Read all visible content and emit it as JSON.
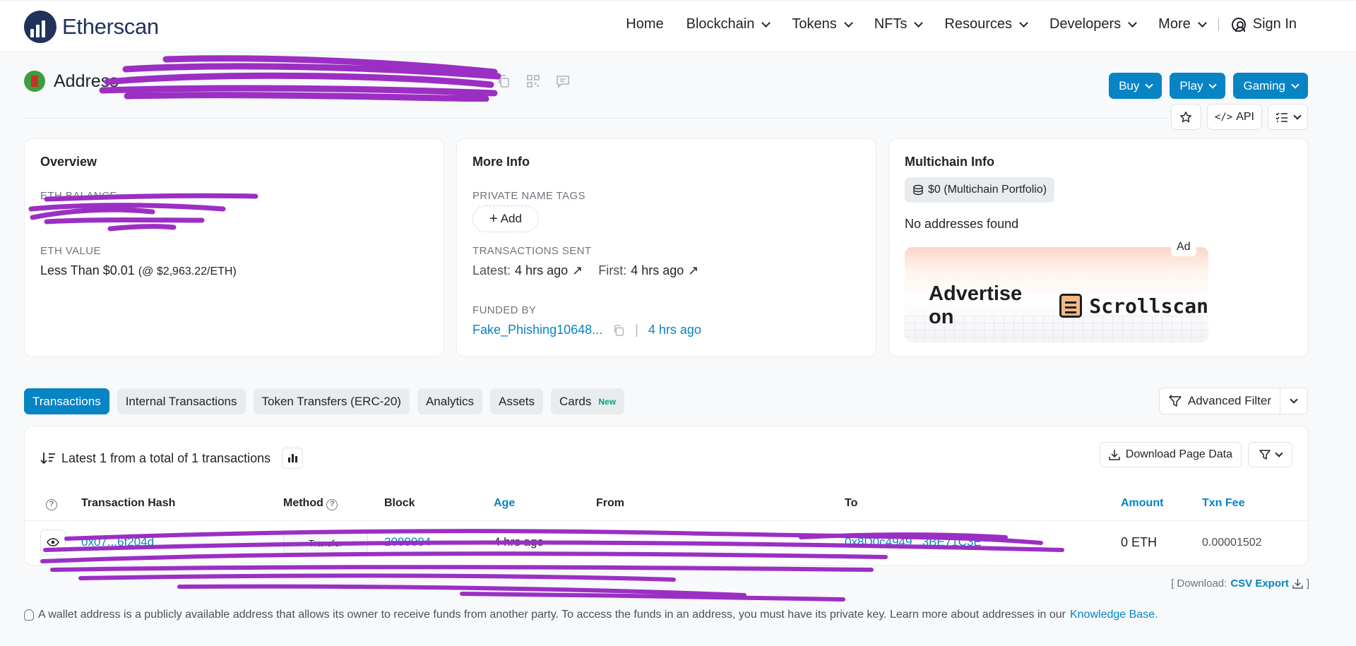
{
  "brand": {
    "name": "Etherscan"
  },
  "nav": {
    "items": [
      {
        "label": "Home",
        "dropdown": false
      },
      {
        "label": "Blockchain",
        "dropdown": true
      },
      {
        "label": "Tokens",
        "dropdown": true
      },
      {
        "label": "NFTs",
        "dropdown": true
      },
      {
        "label": "Resources",
        "dropdown": true
      },
      {
        "label": "Developers",
        "dropdown": true
      },
      {
        "label": "More",
        "dropdown": true
      }
    ],
    "sign_in": "Sign In"
  },
  "address_header": {
    "title": "Address",
    "buttons": [
      "Buy",
      "Play",
      "Gaming"
    ],
    "api_label": "API"
  },
  "overview": {
    "title": "Overview",
    "eth_balance_label": "ETH BALANCE",
    "eth_value_label": "ETH VALUE",
    "eth_value": "Less Than $0.01",
    "eth_price": "(@ $2,963.22/ETH)"
  },
  "more_info": {
    "title": "More Info",
    "private_tags_label": "PRIVATE NAME TAGS",
    "add_label": "Add",
    "tx_sent_label": "TRANSACTIONS SENT",
    "latest_label": "Latest:",
    "latest_value": "4 hrs ago",
    "first_label": "First:",
    "first_value": "4 hrs ago",
    "funded_by_label": "FUNDED BY",
    "funded_by_value": "Fake_Phishing10648...",
    "funded_age": "4 hrs ago"
  },
  "multichain": {
    "title": "Multichain Info",
    "portfolio": "$0 (Multichain Portfolio)",
    "no_addresses": "No addresses found",
    "ad_text": "Advertise on",
    "ad_brand": "Scrollscan",
    "ad_badge": "Ad"
  },
  "tabs": [
    {
      "label": "Transactions",
      "active": true
    },
    {
      "label": "Internal Transactions",
      "active": false
    },
    {
      "label": "Token Transfers (ERC-20)",
      "active": false
    },
    {
      "label": "Analytics",
      "active": false
    },
    {
      "label": "Assets",
      "active": false
    },
    {
      "label": "Cards",
      "active": false,
      "badge": "New"
    }
  ],
  "advanced_filter": "Advanced Filter",
  "transactions": {
    "summary": "Latest 1 from a total of 1 transactions",
    "download_label": "Download Page Data",
    "columns": [
      "Transaction Hash",
      "Method",
      "Block",
      "Age",
      "From",
      "To",
      "Amount",
      "Txn Fee"
    ],
    "rows": [
      {
        "hash": "0x07...6f204d",
        "method": "Transfer",
        "block": "2080084",
        "age": "4 hrs ago",
        "to": "0x8D0c4949...3BE71C3E",
        "amount": "0 ETH",
        "fee": "0.00001502"
      }
    ]
  },
  "csv": {
    "prefix": "[ Download:",
    "link": "CSV Export",
    "suffix": "]"
  },
  "footer": {
    "note": "A wallet address is a publicly available address that allows its owner to receive funds from another party. To access the funds in an address, you must have its private key. Learn more about addresses in our",
    "link": "Knowledge Base."
  },
  "colors": {
    "primary": "#0784c3",
    "scribble": "#9b2fc4"
  }
}
